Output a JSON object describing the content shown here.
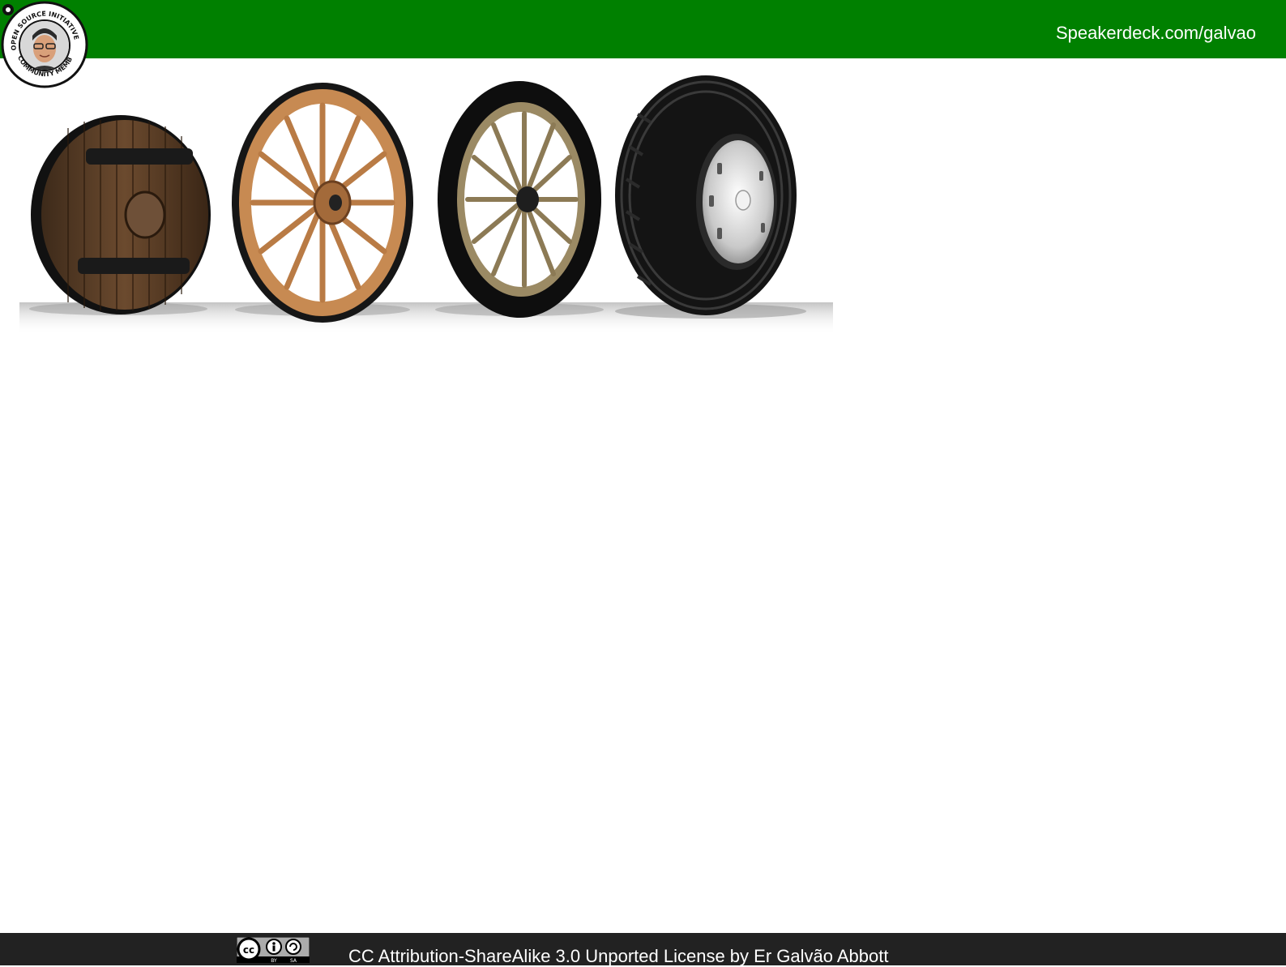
{
  "header": {
    "link_text": "Speakerdeck.com/galvao",
    "background": "#008000"
  },
  "badge": {
    "ring_text_top": "OPEN SOURCE INITIATIVE",
    "ring_text_bottom": "COMMUNITY MEMBER",
    "icon": "osi-community-member-avatar-icon"
  },
  "slide": {
    "image": "wheel-evolution-image",
    "wheels": [
      "wooden-disc-wheel",
      "wooden-spoke-wheel",
      "rubber-spoke-wheel",
      "modern-tire"
    ]
  },
  "footer": {
    "license_text": "CC Attribution-ShareAlike 3.0 Unported License by Er Galvão Abbott",
    "icon": "cc-by-sa-icon",
    "background": "#222222"
  }
}
